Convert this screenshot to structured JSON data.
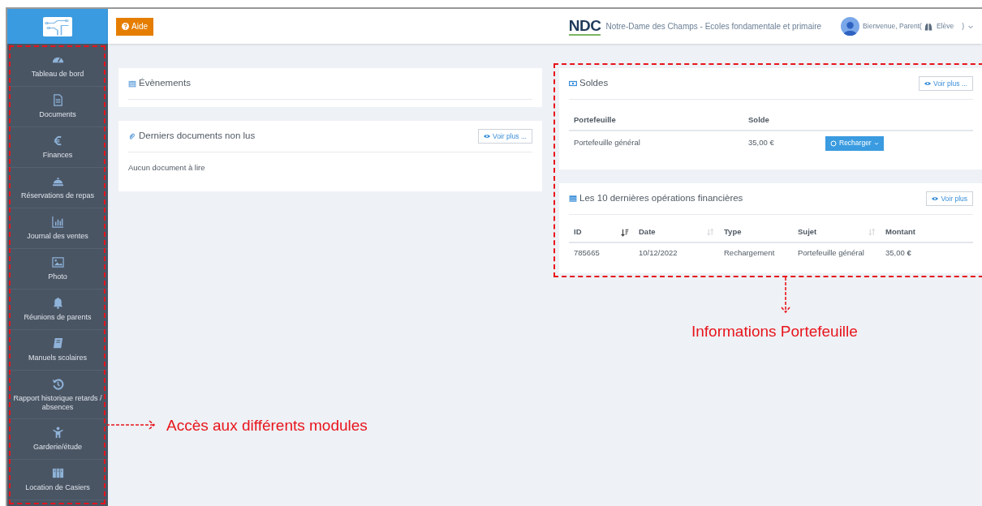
{
  "header": {
    "help_button": "Aide",
    "logo": "NDC",
    "school": "Notre-Dame des Champs - Ecoles fondamentale et primaire",
    "welcome": "Bienvenue, Parent(",
    "student": "Elève",
    "close_paren": ")"
  },
  "sidebar": {
    "items": [
      {
        "label": "Tableau de bord"
      },
      {
        "label": "Documents"
      },
      {
        "label": "Finances"
      },
      {
        "label": "Réservations de repas"
      },
      {
        "label": "Journal des ventes"
      },
      {
        "label": "Photo"
      },
      {
        "label": "Réunions de parents"
      },
      {
        "label": "Manuels scolaires"
      },
      {
        "label": "Rapport historique retards / absences"
      },
      {
        "label": "Garderie/étude"
      },
      {
        "label": "Location de Casiers"
      }
    ]
  },
  "events": {
    "title": "Évènements"
  },
  "documents": {
    "title": "Derniers documents non lus",
    "more": "Voir plus ...",
    "empty": "Aucun document à lire"
  },
  "balances": {
    "title": "Soldes",
    "more": "Voir plus ...",
    "columns": [
      "Portefeuille",
      "Solde"
    ],
    "rows": [
      {
        "wallet": "Portefeuille général",
        "balance": "35,00 €",
        "action": "Recharger"
      }
    ]
  },
  "operations": {
    "title": "Les 10 dernières opérations financières",
    "more": "Voir plus",
    "columns": [
      {
        "label": "ID",
        "sorted": true
      },
      {
        "label": "Date",
        "sorted": false
      },
      {
        "label": "Type"
      },
      {
        "label": "Sujet",
        "sorted": false
      },
      {
        "label": "Montant"
      }
    ],
    "rows": [
      [
        "785665",
        "10/12/2022",
        "Rechargement",
        "Portefeuille général",
        "35,00 **€**"
      ]
    ]
  },
  "annotations": [
    {
      "text": "Accès aux différents modules"
    },
    {
      "text": "Informations Portefeuille"
    }
  ]
}
